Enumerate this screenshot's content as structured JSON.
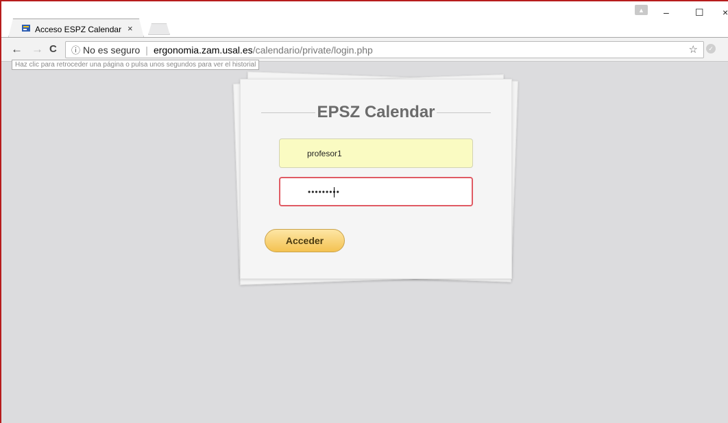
{
  "browser": {
    "tab_title": "Acceso ESPZ Calendar",
    "tab_close": "×",
    "window_controls": {
      "minimize": "–",
      "maximize": "☐",
      "close": "×"
    },
    "nav": {
      "back": "←",
      "forward": "→",
      "reload": "C"
    },
    "address": {
      "security_label": "No es seguro",
      "host": "ergonomia.zam.usal.es",
      "path": "/calendario/private/login.php"
    },
    "tooltip": "Haz clic para retroceder una página o pulsa unos segundos para ver el historial",
    "icons": [
      "favicon-icon",
      "info-icon",
      "star-icon",
      "profile-icon",
      "extension-icon"
    ]
  },
  "login": {
    "title": "EPSZ Calendar",
    "username_value": "profesor1",
    "password_value": "•••••••••",
    "submit_label": "Acceder"
  },
  "colors": {
    "frame_border": "#b71c1c",
    "page_background": "#dcdcde",
    "autofill_yellow": "#fafbc2",
    "password_focus_border": "#e05a63",
    "button_gradient": [
      "#fde6a5",
      "#f4c251"
    ]
  }
}
